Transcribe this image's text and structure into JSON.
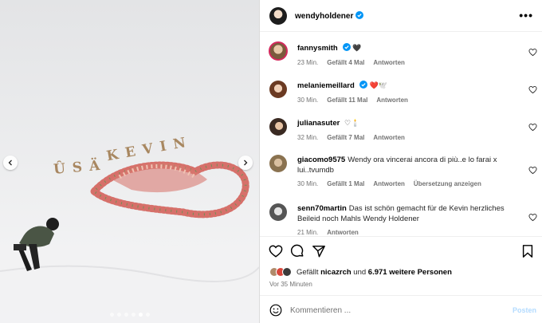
{
  "post": {
    "author": "wendyholdener",
    "more_icon": "ellipsis-icon",
    "media": {
      "snow_words": [
        "ÛSÄ",
        "KEVIN"
      ],
      "carousel_dots": 6,
      "active_dot": 4
    }
  },
  "comments": [
    {
      "user": "fannysmith",
      "verified": true,
      "text": "🖤",
      "time": "23 Min.",
      "likes": "Gefällt 4 Mal",
      "reply": "Antworten",
      "extra": ""
    },
    {
      "user": "melaniemeillard",
      "verified": true,
      "text": "❤️🕊️",
      "time": "30 Min.",
      "likes": "Gefällt 11 Mal",
      "reply": "Antworten",
      "extra": ""
    },
    {
      "user": "julianasuter",
      "verified": false,
      "text": "♡🕯️",
      "time": "32 Min.",
      "likes": "Gefällt 7 Mal",
      "reply": "Antworten",
      "extra": ""
    },
    {
      "user": "giacomo9575",
      "verified": false,
      "text": "Wendy ora vincerai ancora di più..e lo farai x lui..tvumdb",
      "time": "30 Min.",
      "likes": "Gefällt 1 Mal",
      "reply": "Antworten",
      "extra": "Übersetzung anzeigen"
    },
    {
      "user": "senn70martin",
      "verified": false,
      "text": "Das ist schön gemacht für de Kevin herzliches Beileid noch Mahls Wendy Holdener",
      "time": "21 Min.",
      "likes": "",
      "reply": "Antworten",
      "extra": ""
    }
  ],
  "likes": {
    "prefix": "Gefällt",
    "first_user": "nicazrch",
    "middle": "und",
    "count": "6.971 weitere Personen"
  },
  "time_ago": "Vor 35 Minuten",
  "comment_box": {
    "placeholder": "Kommentieren ...",
    "post_label": "Posten"
  },
  "colors": {
    "verified": "#0095f6",
    "heart_red": "#e0245e",
    "post_disabled": "#b3dbff",
    "meta_gray": "#737373"
  }
}
